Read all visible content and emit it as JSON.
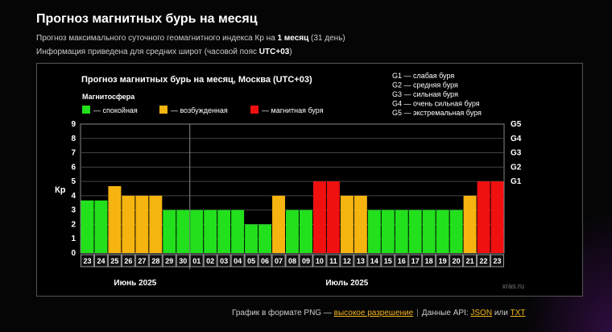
{
  "page": {
    "title": "Прогноз магнитных бурь на месяц",
    "desc1": {
      "before": "Прогноз максимального суточного геомагнитного индекса Кр на ",
      "bold": "1 месяц",
      "after": " (31 день)"
    },
    "desc2": {
      "before": "Информация приведена для средних широт (часовой пояс ",
      "bold": "UTC+03",
      "after": ")"
    }
  },
  "footer": {
    "png_text": "График в формате PNG — ",
    "hires_link": "высокое разрешение",
    "sep": "|",
    "api_text": "Данные API: ",
    "json_link": "JSON",
    "or_text": " или ",
    "txt_link": "TXT"
  },
  "colors": {
    "calm": "#22e01b",
    "excited": "#f5b40f",
    "storm": "#f01010",
    "link": "#f5b81c"
  },
  "chart_data": {
    "type": "bar",
    "title": "Прогноз магнитных бурь на месяц, Москва (UTC+03)",
    "ylabel": "Кр",
    "ylim": [
      0,
      9
    ],
    "yticks": [
      0,
      1,
      2,
      3,
      4,
      5,
      6,
      7,
      8,
      9
    ],
    "grid": true,
    "legend_title": "Магнитосфера",
    "legend": [
      {
        "label": "— спокойная",
        "color": "#22e01b"
      },
      {
        "label": "— возбужденная",
        "color": "#f5b40f"
      },
      {
        "label": "— магнитная буря",
        "color": "#f01010"
      }
    ],
    "g_scale": [
      {
        "level": "G5",
        "kp": 9,
        "description": "G5 — экстремальная буря"
      },
      {
        "level": "G4",
        "kp": 8,
        "description": "G4 — очень сильная буря"
      },
      {
        "level": "G3",
        "kp": 7,
        "description": "G3 — сильная буря"
      },
      {
        "level": "G2",
        "kp": 6,
        "description": "G2 — средняя буря"
      },
      {
        "level": "G1",
        "kp": 5,
        "description": "G1 — слабая буря"
      }
    ],
    "categories": [
      "23",
      "24",
      "25",
      "26",
      "27",
      "28",
      "29",
      "30",
      "01",
      "02",
      "03",
      "04",
      "05",
      "06",
      "07",
      "08",
      "09",
      "10",
      "11",
      "12",
      "13",
      "14",
      "15",
      "16",
      "17",
      "18",
      "19",
      "20",
      "21",
      "22",
      "23"
    ],
    "values": [
      3.67,
      3.67,
      4.67,
      4.0,
      4.0,
      4.0,
      3.0,
      3.0,
      3.0,
      3.0,
      3.0,
      3.0,
      2.0,
      2.0,
      4.0,
      3.0,
      3.0,
      5.0,
      5.0,
      4.0,
      4.0,
      3.0,
      3.0,
      3.0,
      3.0,
      3.0,
      3.0,
      3.0,
      4.0,
      5.0,
      5.0
    ],
    "month_labels": [
      {
        "label": "Июнь 2025",
        "first_index": 0,
        "last_index": 7
      },
      {
        "label": "Июль 2025",
        "first_index": 8,
        "last_index": 30
      }
    ],
    "month_divider_after_index": 7,
    "watermark": "xras.ru"
  }
}
